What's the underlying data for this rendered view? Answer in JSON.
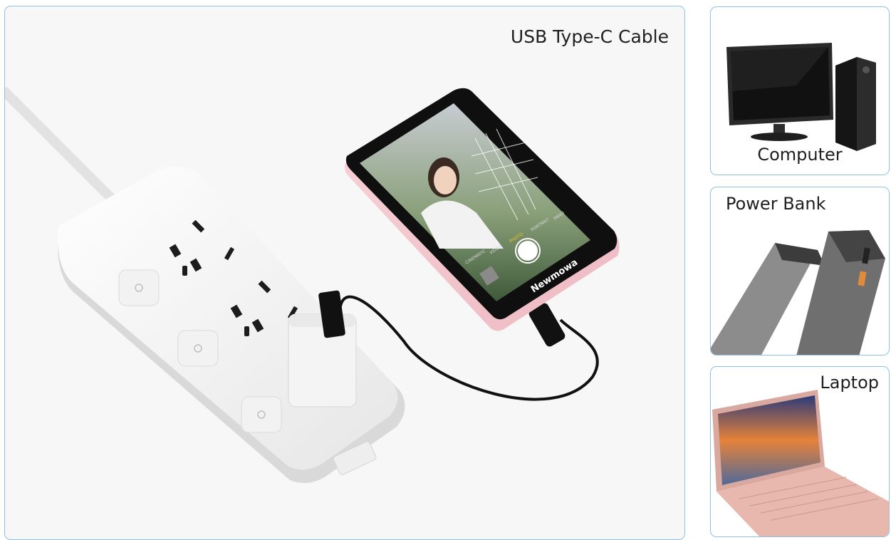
{
  "main": {
    "caption": "USB Type-C Cable",
    "phone_brand": "Newmowa",
    "camera_modes": [
      "CINEMATIC",
      "VIDEO",
      "PHOTO",
      "PORTRAIT",
      "PANO"
    ],
    "camera_active_mode": "PHOTO"
  },
  "devices": [
    {
      "label": "Computer"
    },
    {
      "label": "Power Bank"
    },
    {
      "label": "Laptop"
    }
  ],
  "colors": {
    "panel_border": "#8fc3e6",
    "phone_case": "#f3c9d0",
    "active_mode": "#f5c518"
  }
}
